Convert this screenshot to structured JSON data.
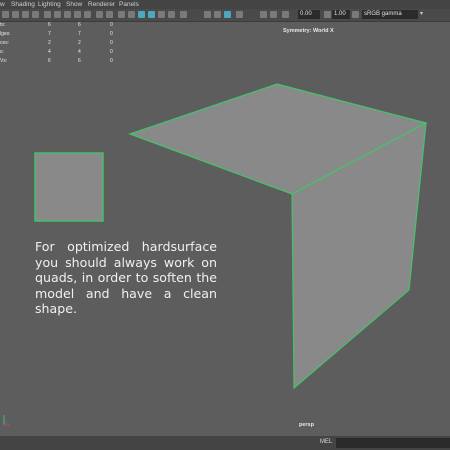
{
  "menu": {
    "items": [
      "w",
      "Shading",
      "Lighting",
      "Show",
      "Renderer",
      "Panels"
    ]
  },
  "toolbar": {
    "field_a": "0.00",
    "field_b": "1.00",
    "color_space": "sRGB gamma"
  },
  "hud": {
    "rows": [
      {
        "label": "ts:",
        "a": "6",
        "b": "6",
        "c": "0"
      },
      {
        "label": "lges:",
        "a": "7",
        "b": "7",
        "c": "0"
      },
      {
        "label": "ces:",
        "a": "2",
        "b": "2",
        "c": "0"
      },
      {
        "label": "s:",
        "a": "4",
        "b": "4",
        "c": "0"
      },
      {
        "label": "Vs:",
        "a": "6",
        "b": "6",
        "c": "0"
      }
    ]
  },
  "viewport": {
    "symmetry": "Symmetry: World X",
    "camera": "persp",
    "caption": "For optimized hardsurface you should always work on quads, in order to soften the model and have a clean shape.",
    "wire_color": "#43c46a",
    "face_color": "#898989"
  },
  "status": {
    "mel_label": "MEL"
  }
}
